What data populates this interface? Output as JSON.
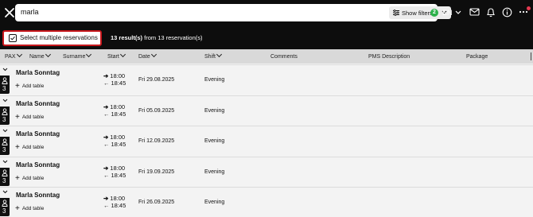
{
  "topbar": {
    "search_value": "marla",
    "show_filters_label": "Show filters",
    "filters_count": "2",
    "language": "EN"
  },
  "toolbar": {
    "select_multiple_label": "Select multiple reservations",
    "results_count": "13 result(s)",
    "results_suffix": "from 13 reservation(s)"
  },
  "columns": [
    "PAX",
    "Name",
    "Surname",
    "Start",
    "Date",
    "Shift",
    "Comments",
    "PMS Description",
    "Package"
  ],
  "rows": [
    {
      "pax": "3",
      "name": "Marla Sonntag",
      "add_table": "Add table",
      "start": "18:00",
      "end": "18:45",
      "date": "Fri 29.08.2025",
      "shift": "Evening"
    },
    {
      "pax": "3",
      "name": "Marla Sonntag",
      "add_table": "Add table",
      "start": "18:00",
      "end": "18:45",
      "date": "Fri 05.09.2025",
      "shift": "Evening"
    },
    {
      "pax": "3",
      "name": "Marla Sonntag",
      "add_table": "Add table",
      "start": "18:00",
      "end": "18:45",
      "date": "Fri 12.09.2025",
      "shift": "Evening"
    },
    {
      "pax": "3",
      "name": "Marla Sonntag",
      "add_table": "Add table",
      "start": "18:00",
      "end": "18:45",
      "date": "Fri 19.09.2025",
      "shift": "Evening"
    },
    {
      "pax": "3",
      "name": "Marla Sonntag",
      "add_table": "Add table",
      "start": "18:00",
      "end": "18:45",
      "date": "Fri 26.09.2025",
      "shift": "Evening"
    }
  ],
  "colors": {
    "accent_red": "#c8171c",
    "badge_green": "#2db24b",
    "notification": "#e53950"
  }
}
